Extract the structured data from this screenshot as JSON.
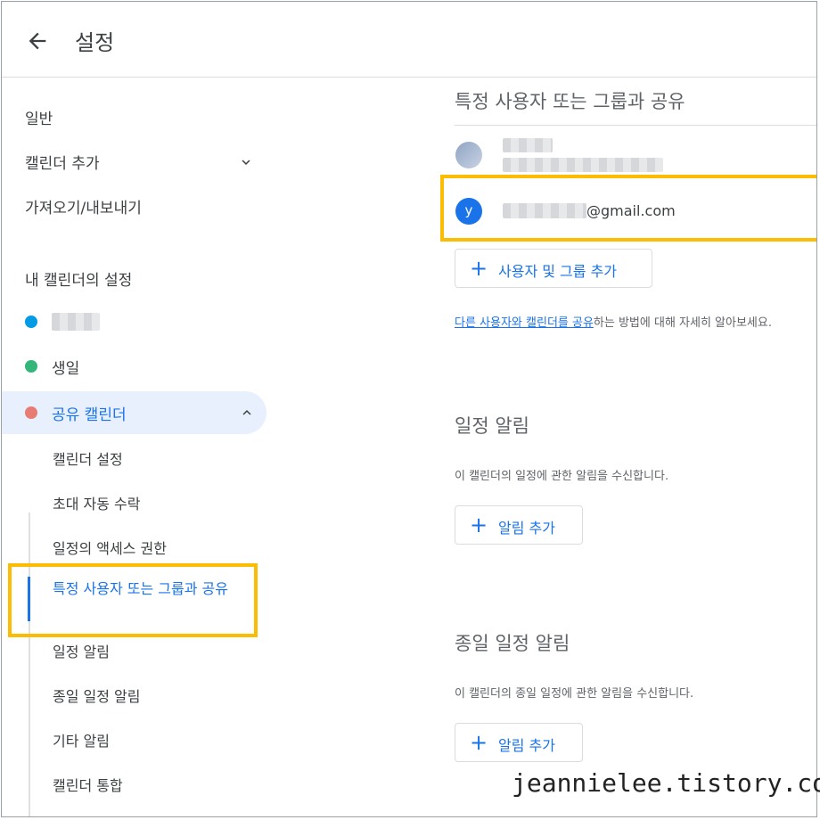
{
  "header": {
    "title": "설정",
    "back_icon": "arrow-back-icon"
  },
  "sidebar": {
    "general": "일반",
    "add_calendar": "캘린더 추가",
    "import_export": "가져오기/내보내기",
    "my_calendars_heading": "내 캘린더의 설정",
    "calendars": [
      {
        "label": "",
        "color": "#039be5"
      },
      {
        "label": "생일",
        "color": "#33b679"
      },
      {
        "label": "공유 캘린더",
        "color": "#e67c73"
      }
    ],
    "sub_items": [
      "캘린더 설정",
      "초대 자동 수락",
      "일정의 액세스 권한",
      "특정 사용자 또는 그룹과 공유",
      "일정 알림",
      "종일 일정 알림",
      "기타 알림",
      "캘린더 통합"
    ]
  },
  "main": {
    "share_title": "특정 사용자 또는 그룹과 공유",
    "shared_user": {
      "avatar_letter": "y",
      "email_suffix": "@gmail.com"
    },
    "add_people_button": "사용자 및 그룹 추가",
    "help_link": "다른 사용자와 캘린더를 공유",
    "help_rest": "하는 방법에 대해 자세히 알아보세요.",
    "event_alerts_title": "일정 알림",
    "event_alerts_desc": "이 캘린더의 일정에 관한 알림을 수신합니다.",
    "add_alert_button": "알림 추가",
    "allday_alerts_title": "종일 일정 알림",
    "allday_alerts_desc": "이 캘린더의 종일 일정에 관한 알림을 수신합니다.",
    "add_allday_alert_button": "알림 추가"
  },
  "colors": {
    "accent": "#1a73e8",
    "highlight": "#fbbc04",
    "active_bg": "#e8f0fe"
  },
  "watermark": "jeannielee.tistory.com"
}
